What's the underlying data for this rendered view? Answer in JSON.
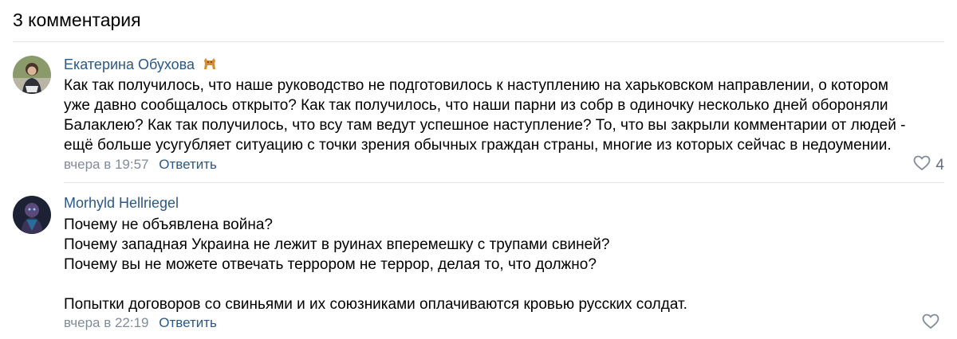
{
  "header": {
    "title": "3 комментария"
  },
  "comments": [
    {
      "author": "Екатерина Обухова",
      "lines": [
        "Как так получилось, что наше руководство не подготовилось к наступлению на харьковском направлении, о котором",
        "уже давно сообщалось открыто? Как так получилось, что наши парни из собр в одиночку несколько дней обороняли",
        "Балаклею? Как так получилось, что всу там ведут успешное наступление? То, что вы закрыли комментарии от людей -",
        "ещё больше усугубляет ситуацию с точки зрения обычных граждан страны, многие из которых сейчас в недоумении."
      ],
      "time": "вчера в 19:57",
      "reply_label": "Ответить",
      "likes": "4"
    },
    {
      "author": "Morhyld Hellriegel",
      "lines": [
        "Почему не объявлена война?",
        "Почему западная Украина не лежит в руинах вперемешку с трупами свиней?",
        "Почему вы не можете отвечать террором не террор, делая то, что должно?",
        "",
        "Попытки договоров со свиньями и их союзниками оплачиваются кровью русских солдат."
      ],
      "time": "вчера в 22:19",
      "reply_label": "Ответить",
      "likes": ""
    }
  ],
  "colors": {
    "link": "#2a5885",
    "muted": "#818c99",
    "divider": "#e1e3e6"
  },
  "icons": {
    "author_badge": "dog-icon",
    "like": "heart-icon"
  }
}
